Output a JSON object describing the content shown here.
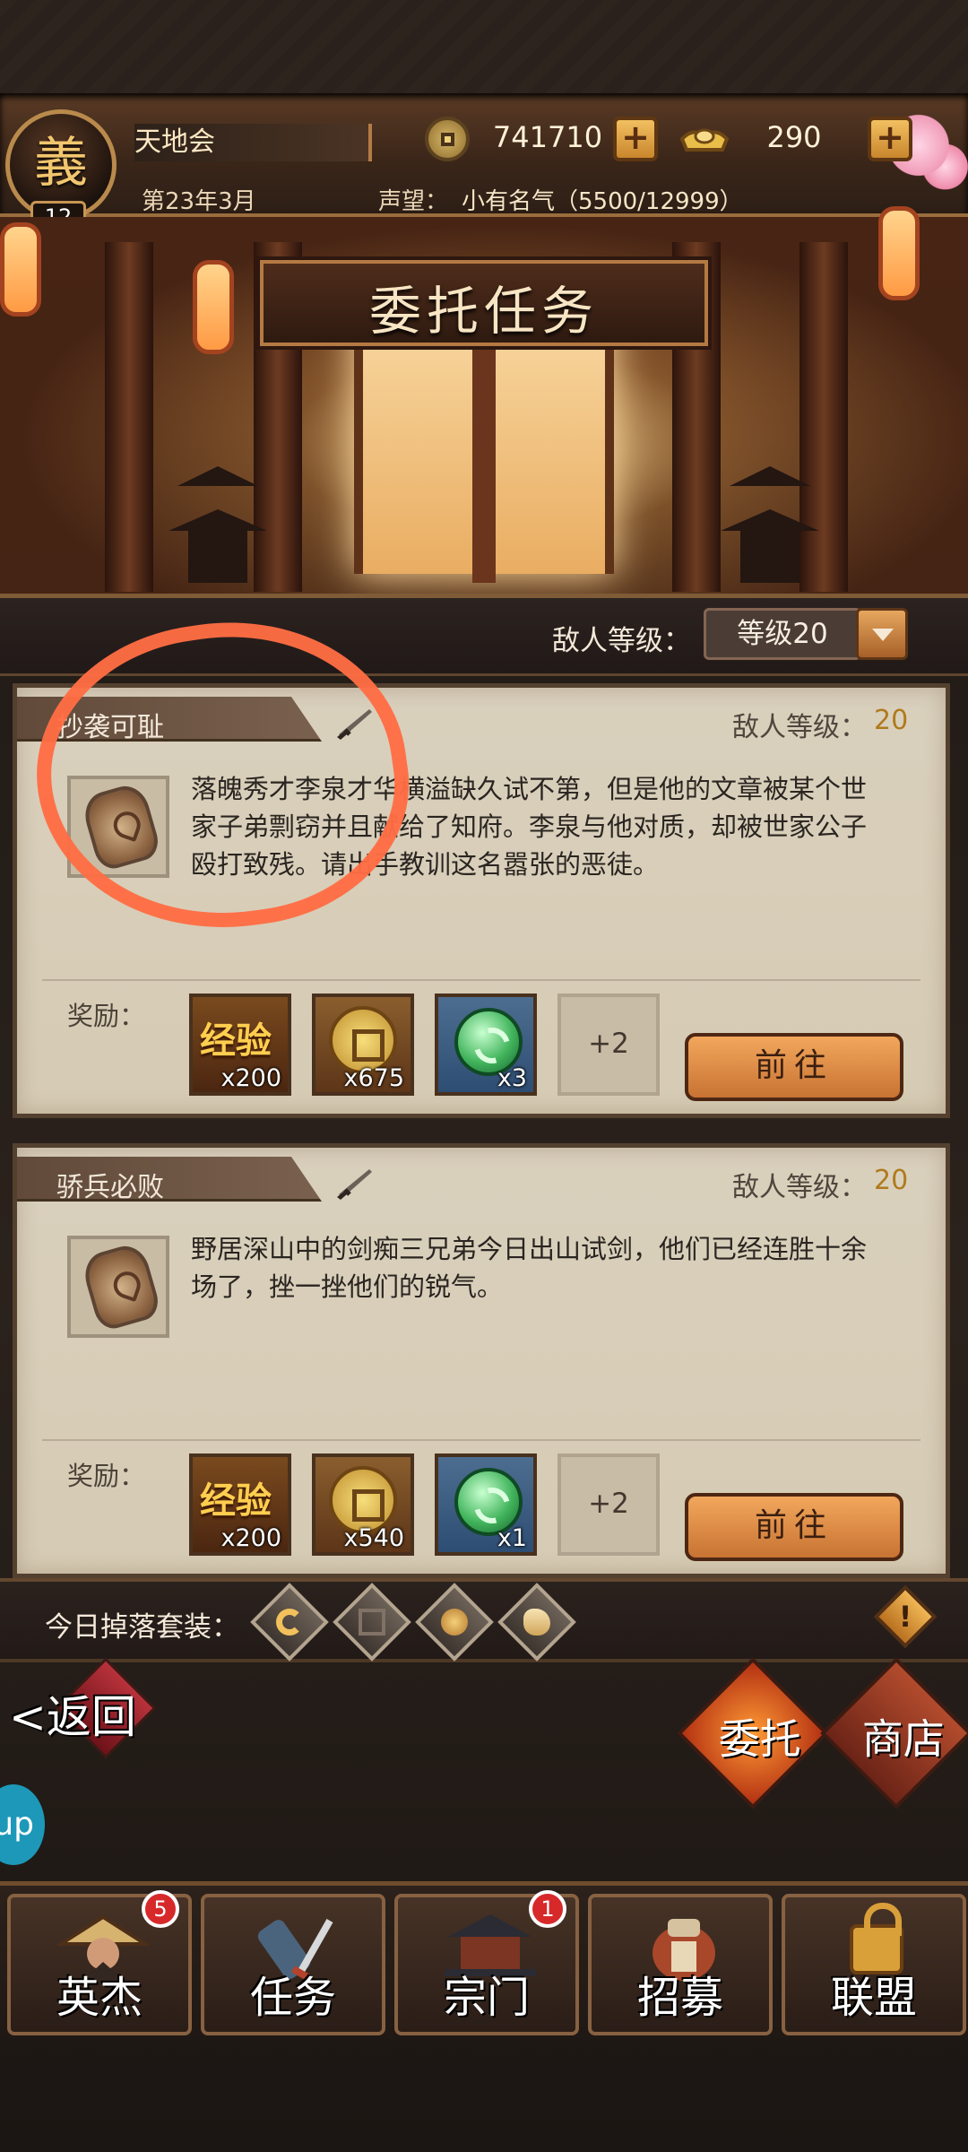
{
  "header": {
    "guild_name": "天地会",
    "emblem_glyph": "義",
    "level": "12",
    "date": "第23年3月",
    "reputation_label": "声望：",
    "reputation_value": "小有名气（5500/12999）",
    "coins": "741710",
    "ingots": "290",
    "plus_symbol": "+"
  },
  "title": "委托任务",
  "filter": {
    "label": "敌人等级：",
    "selected": "等级20"
  },
  "tasks": [
    {
      "title": "抄袭可耻",
      "enemy_label": "敌人等级：",
      "enemy_level": "20",
      "description": "落魄秀才李泉才华横溢缺久试不第，但是他的文章被某个世家子弟剽窃并且献给了知府。李泉与他对质，却被世家公子殴打致残。请出手教训这名嚣张的恶徒。",
      "reward_label": "奖励：",
      "rewards": [
        {
          "type": "经验",
          "amount": "x200"
        },
        {
          "type": "coin",
          "amount": "x675"
        },
        {
          "type": "jade",
          "amount": "x3"
        },
        {
          "type": "more",
          "amount": "+2"
        }
      ],
      "button": "前往"
    },
    {
      "title": "骄兵必败",
      "enemy_label": "敌人等级：",
      "enemy_level": "20",
      "description": "野居深山中的剑痴三兄弟今日出山试剑，他们已经连胜十余场了，挫一挫他们的锐气。",
      "reward_label": "奖励：",
      "rewards": [
        {
          "type": "经验",
          "amount": "x200"
        },
        {
          "type": "coin",
          "amount": "x540"
        },
        {
          "type": "jade",
          "amount": "x1"
        },
        {
          "type": "more",
          "amount": "+2"
        }
      ],
      "button": "前往"
    }
  ],
  "drops": {
    "label": "今日掉落套装：",
    "alert": "!"
  },
  "side_actions": {
    "back": "<返回",
    "commission": "委托",
    "shop": "商店",
    "float_tab": "up"
  },
  "bottom_nav": [
    {
      "label": "英杰",
      "badge": "5"
    },
    {
      "label": "任务",
      "badge": ""
    },
    {
      "label": "宗门",
      "badge": "1"
    },
    {
      "label": "招募",
      "badge": ""
    },
    {
      "label": "联盟",
      "badge": ""
    }
  ],
  "colors": {
    "accent": "#c87333",
    "highlight": "#ff6d44",
    "level_gold": "#b07a1d"
  }
}
